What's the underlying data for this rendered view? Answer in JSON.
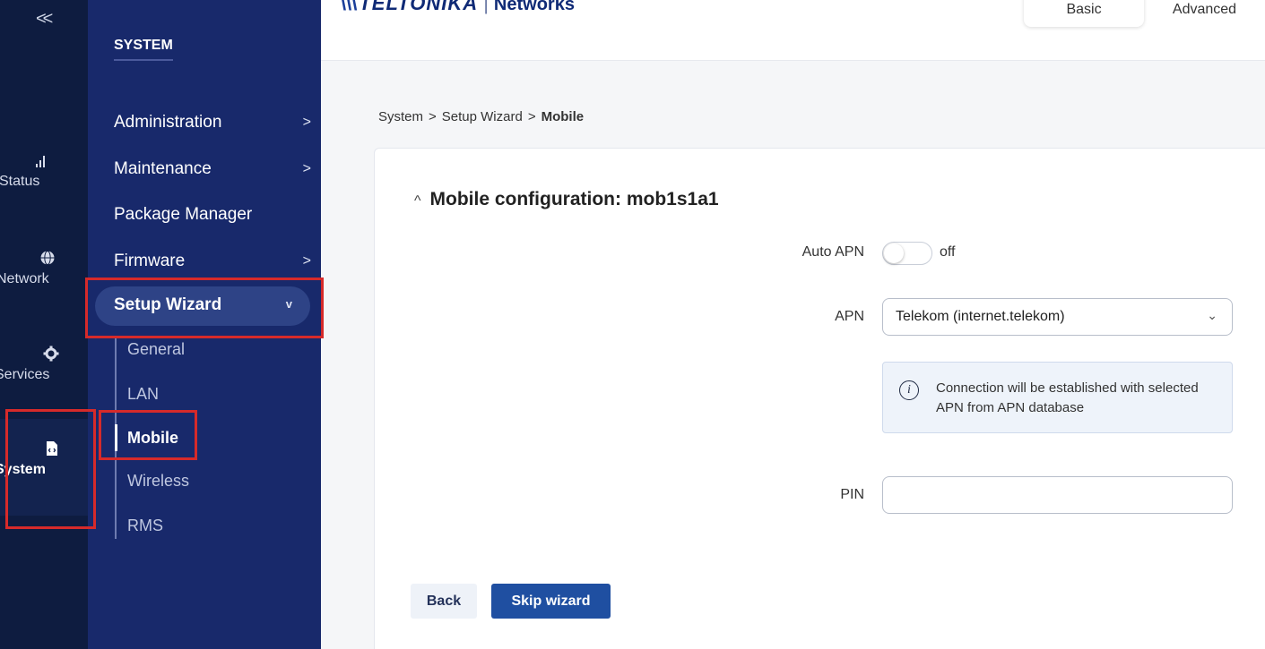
{
  "rail": {
    "collapse": "<<",
    "items": [
      {
        "label": "Status",
        "icon": "signal-icon"
      },
      {
        "label": "Network",
        "icon": "globe-icon"
      },
      {
        "label": "Services",
        "icon": "gear-icon"
      },
      {
        "label": "System",
        "icon": "system-icon"
      }
    ]
  },
  "menu": {
    "title": "SYSTEM",
    "items": [
      {
        "label": "Administration",
        "chevron": ">"
      },
      {
        "label": "Maintenance",
        "chevron": ">"
      },
      {
        "label": "Package Manager"
      },
      {
        "label": "Firmware",
        "chevron": ">"
      },
      {
        "label": "Setup Wizard",
        "chevron": "v"
      }
    ],
    "subitems": [
      "General",
      "LAN",
      "Mobile",
      "Wireless",
      "RMS"
    ]
  },
  "header": {
    "brand": "TELTONIKA",
    "separator": "|",
    "product": "Networks",
    "mode_basic": "Basic",
    "mode_advanced": "Advanced"
  },
  "breadcrumb": {
    "items": [
      "System",
      "Setup Wizard",
      "Mobile"
    ],
    "sep": ">"
  },
  "form": {
    "caret": "^",
    "title": "Mobile configuration: mob1s1a1",
    "auto_apn_label": "Auto APN",
    "auto_apn_state": "off",
    "apn_label": "APN",
    "apn_value": "Telekom (internet.telekom)",
    "info_text": "Connection will be established with selected APN from APN database",
    "pin_label": "PIN",
    "pin_value": ""
  },
  "buttons": {
    "back": "Back",
    "skip": "Skip wizard"
  },
  "colors": {
    "rail": "#0e1c40",
    "menu": "#18296b",
    "primary": "#1f4fa1",
    "highlight": "#d62a2a"
  }
}
